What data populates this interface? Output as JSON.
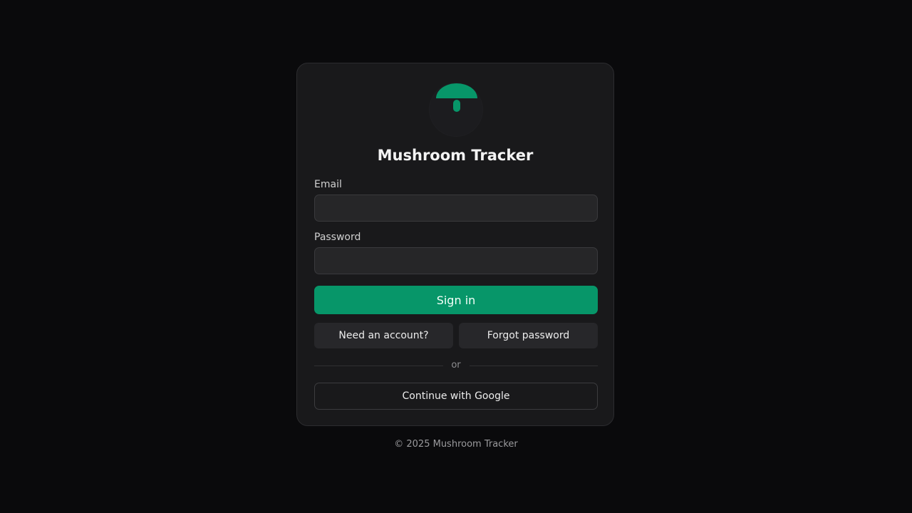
{
  "app": {
    "title": "Mushroom Tracker",
    "logo_icon": "mushroom-icon",
    "accent_color": "#079669"
  },
  "form": {
    "email_label": "Email",
    "email_value": "",
    "email_placeholder": "",
    "password_label": "Password",
    "password_value": "",
    "password_placeholder": "",
    "sign_in_label": "Sign in"
  },
  "links": {
    "need_account_label": "Need an account?",
    "forgot_password_label": "Forgot password"
  },
  "divider": {
    "text": "or"
  },
  "oauth": {
    "google_label": "Continue with Google"
  },
  "footer": {
    "copyright": "© 2025 Mushroom Tracker"
  }
}
